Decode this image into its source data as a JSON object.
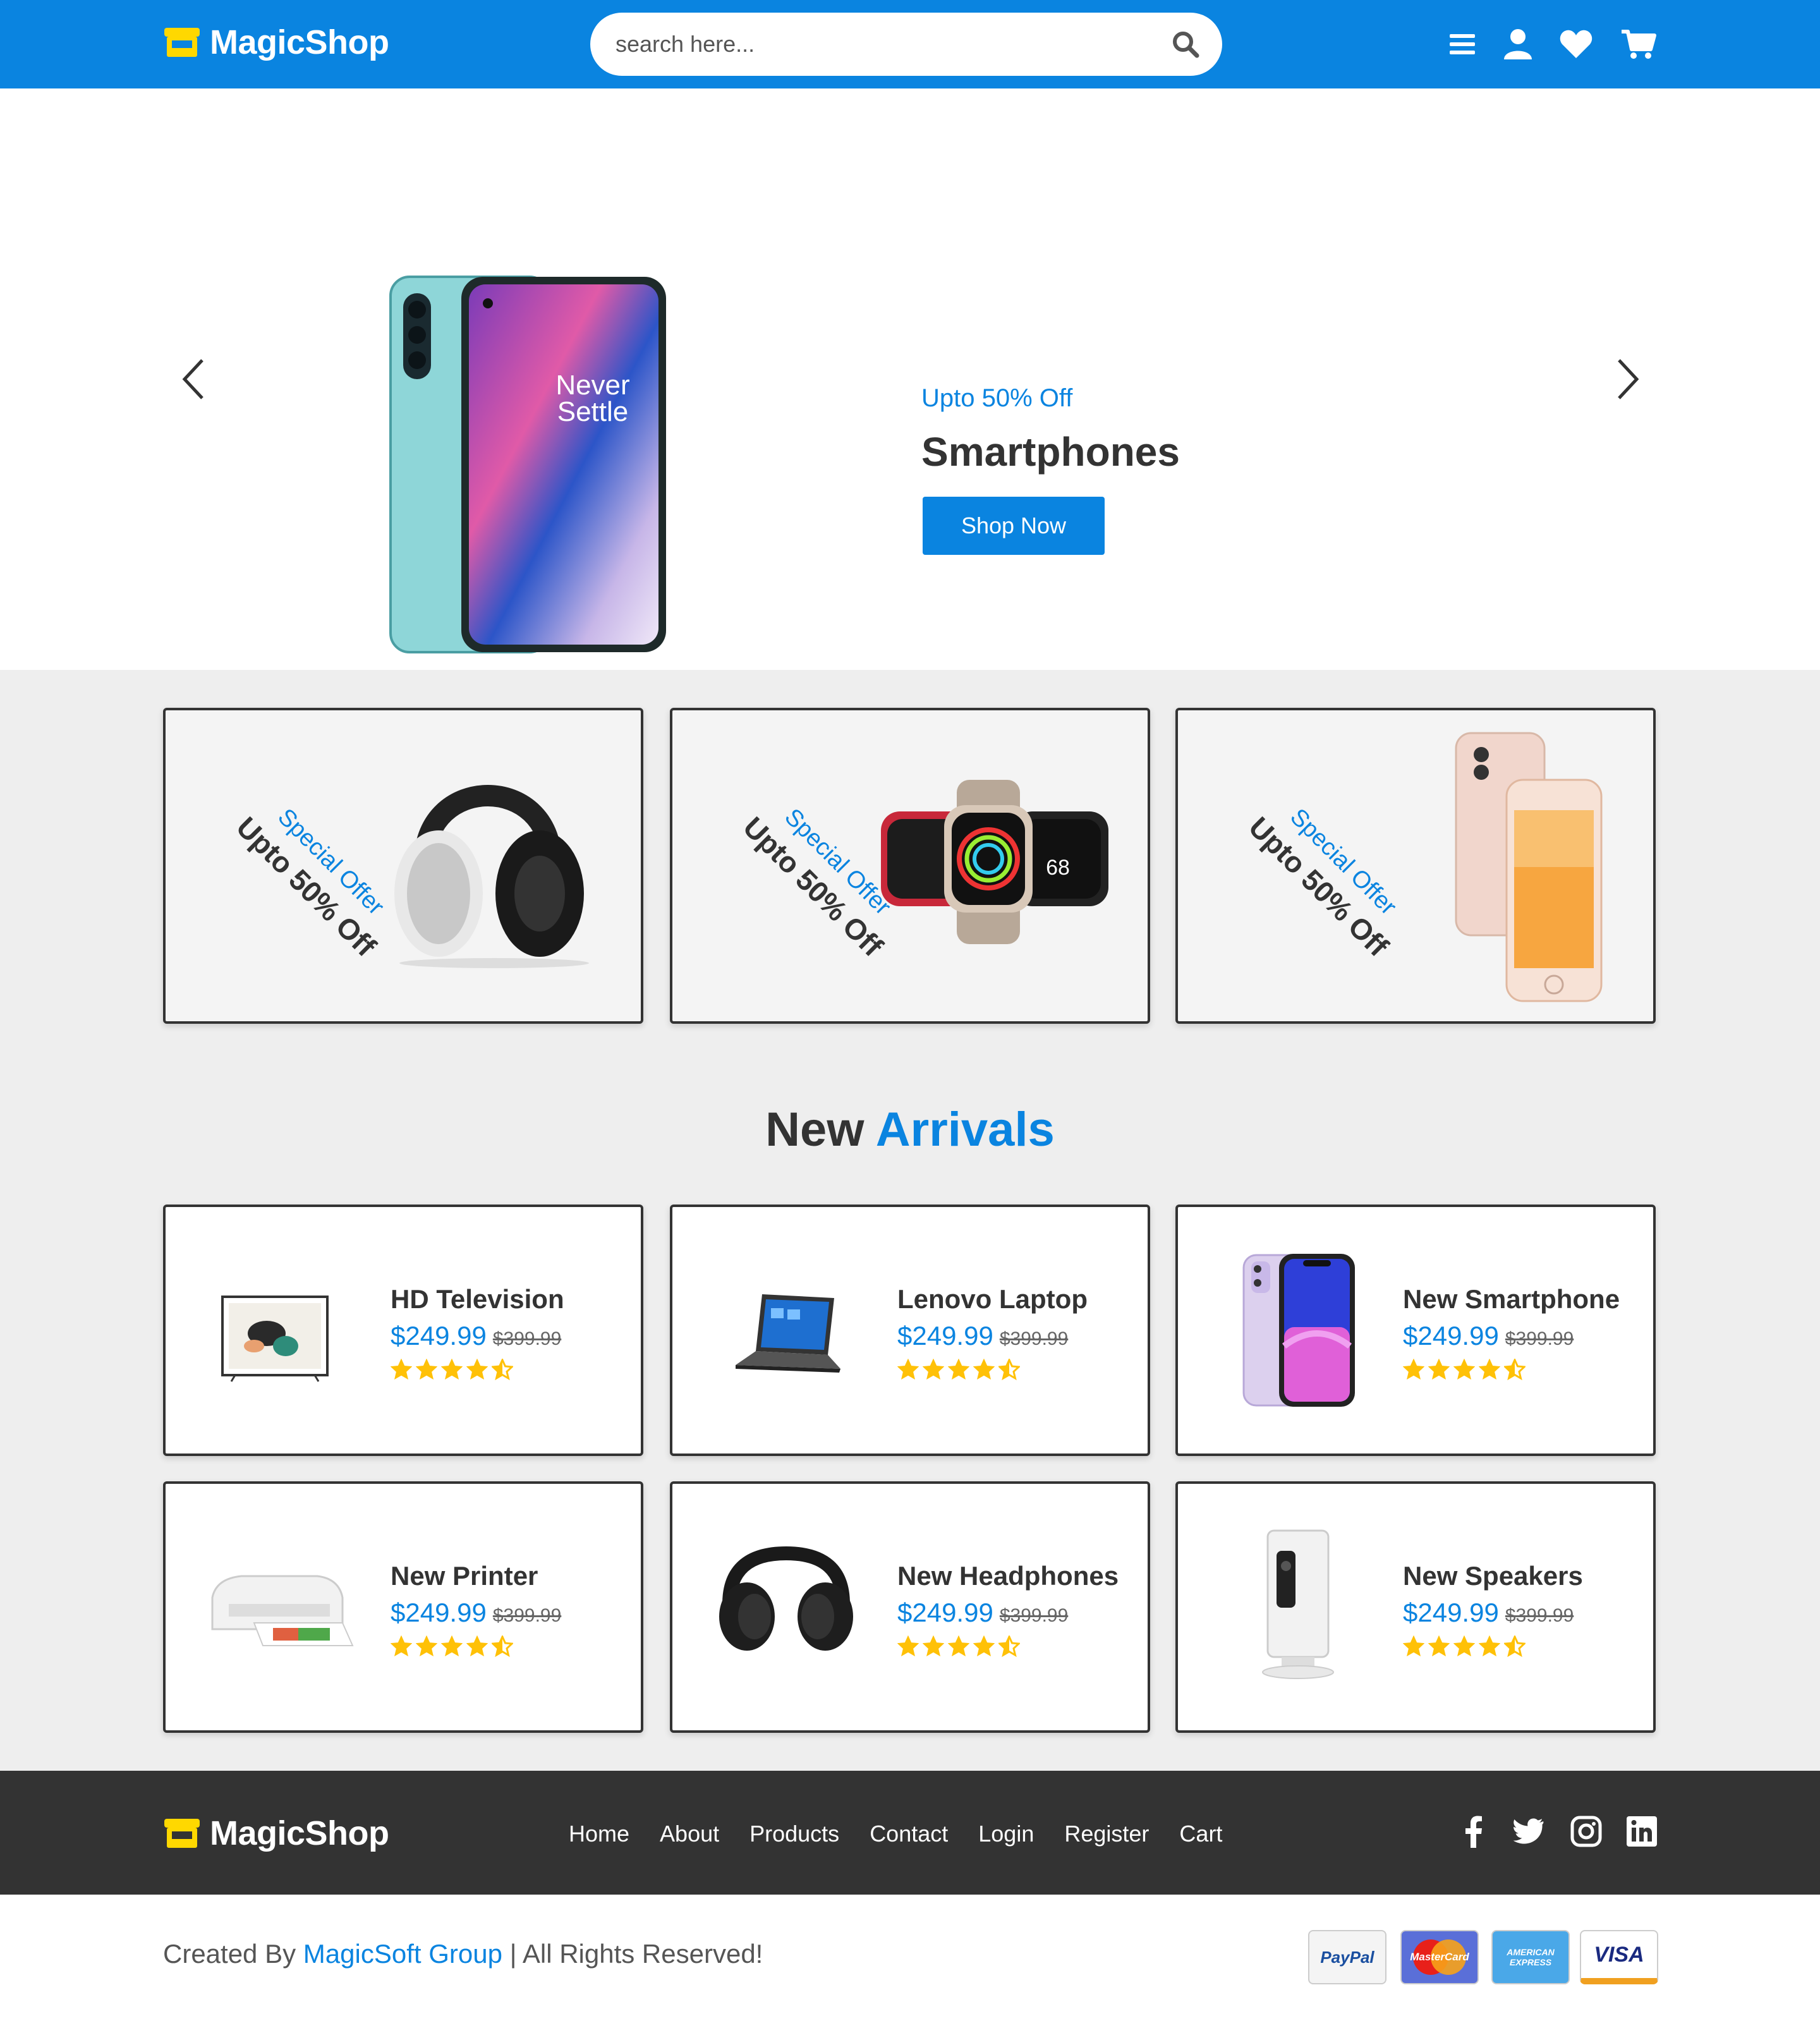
{
  "brand": {
    "name": "MagicShop",
    "logo_icon": "storefront-icon",
    "logo_color": "#ffd800"
  },
  "colors": {
    "primary": "#0a84e0",
    "dark": "#333333",
    "grey_bg": "#eeeeee",
    "star": "#ffc107"
  },
  "header": {
    "search_placeholder": "search here...",
    "icons": [
      "menu-icon",
      "user-icon",
      "heart-icon",
      "cart-icon"
    ]
  },
  "hero": {
    "kicker": "Upto 50% Off",
    "title": "Smartphones",
    "button": "Shop Now",
    "phone_screen_text": "Never Settle"
  },
  "offers": [
    {
      "kicker": "Special Offer",
      "main": "Upto 50% Off",
      "product": "headphones"
    },
    {
      "kicker": "Special Offer",
      "main": "Upto 50% Off",
      "product": "smartwatches"
    },
    {
      "kicker": "Special Offer",
      "main": "Upto 50% Off",
      "product": "iphone"
    }
  ],
  "arrivals": {
    "title_plain": "New",
    "title_accent": "Arrivals",
    "products": [
      {
        "name": "HD Television",
        "price": "$249.99",
        "old_price": "$399.99",
        "rating": 4.5
      },
      {
        "name": "Lenovo Laptop",
        "price": "$249.99",
        "old_price": "$399.99",
        "rating": 4.5
      },
      {
        "name": "New Smartphone",
        "price": "$249.99",
        "old_price": "$399.99",
        "rating": 4.5
      },
      {
        "name": "New Printer",
        "price": "$249.99",
        "old_price": "$399.99",
        "rating": 4.5
      },
      {
        "name": "New Headphones",
        "price": "$249.99",
        "old_price": "$399.99",
        "rating": 4.5
      },
      {
        "name": "New Speakers",
        "price": "$249.99",
        "old_price": "$399.99",
        "rating": 4.5
      }
    ]
  },
  "footer": {
    "nav": [
      "Home",
      "About",
      "Products",
      "Contact",
      "Login",
      "Register",
      "Cart"
    ],
    "social": [
      "facebook-icon",
      "twitter-icon",
      "instagram-icon",
      "linkedin-icon"
    ]
  },
  "bottom": {
    "credit_prefix": "Created By",
    "credit_link": "MagicSoft Group",
    "credit_suffix": "| All Rights Reserved!",
    "payments": [
      "PayPal",
      "MasterCard",
      "AMERICAN EXPRESS",
      "VISA"
    ]
  }
}
